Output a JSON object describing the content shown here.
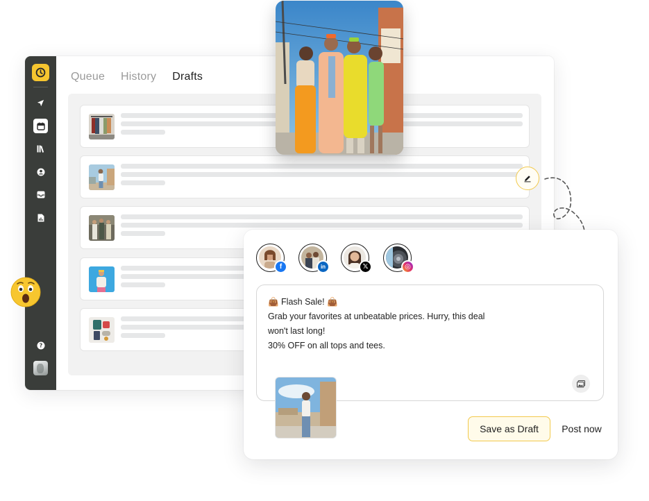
{
  "tabs": [
    {
      "label": "Queue",
      "active": false
    },
    {
      "label": "History",
      "active": false
    },
    {
      "label": "Drafts",
      "active": true
    }
  ],
  "sidebar": {
    "icons": [
      "send-icon",
      "calendar-icon",
      "library-icon",
      "user-icon",
      "inbox-icon",
      "report-icon"
    ],
    "active": "calendar-icon",
    "bottom_icons": [
      "help-icon",
      "user-avatar"
    ]
  },
  "drafts": [
    {
      "thumbnail": "clothing-rack-photo"
    },
    {
      "thumbnail": "person-in-street-photo"
    },
    {
      "thumbnail": "group-of-people-photo"
    },
    {
      "thumbnail": "person-blue-sky-photo"
    },
    {
      "thumbnail": "outfit-flatlay-photo"
    }
  ],
  "composer": {
    "channels": [
      {
        "network": "facebook",
        "badge": "f"
      },
      {
        "network": "linkedin",
        "badge": "in"
      },
      {
        "network": "x",
        "badge": "𝕏"
      },
      {
        "network": "instagram",
        "badge": "◎"
      }
    ],
    "post_text": [
      "👜 Flash Sale! 👜",
      "Grab your favorites at unbeatable prices. Hurry, this deal",
      "won't last long!",
      "30% OFF on all tops and tees."
    ],
    "save_draft_label": "Save as Draft",
    "post_now_label": "Post now"
  },
  "colors": {
    "accent": "#f7c62f",
    "sidebar": "#3a3d3a",
    "facebook": "#1877f2",
    "linkedin": "#0a66c2",
    "x": "#000000",
    "instagram": "#e1306c"
  }
}
